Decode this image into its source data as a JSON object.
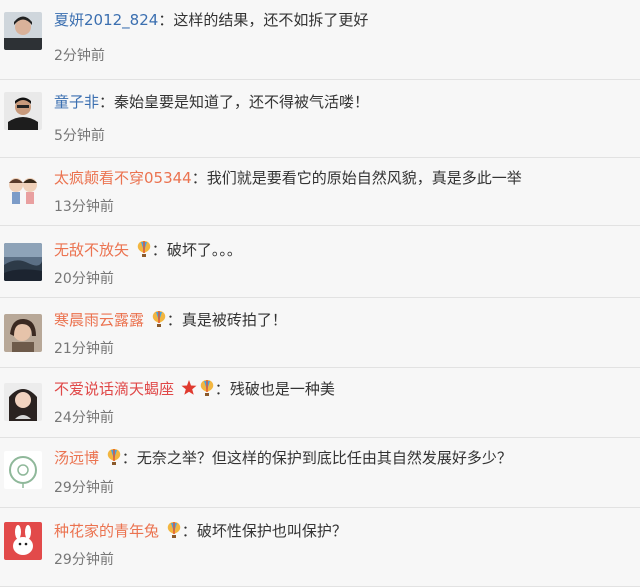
{
  "comments": [
    {
      "user": "夏妍2012_824",
      "text": "这样的结果，还不如拆了更好",
      "time": "2分钟前"
    },
    {
      "user": "童子非",
      "text": "秦始皇要是知道了，还不得被气活喽！",
      "time": "5分钟前"
    },
    {
      "user": "太疯颠看不穿05344",
      "text": "我们就是要看它的原始自然风貌，真是多此一举",
      "time": "13分钟前"
    },
    {
      "user": "无敌不放矢",
      "text": "破坏了。。。",
      "time": "20分钟前"
    },
    {
      "user": "寒晨雨云露露",
      "text": "真是被砖拍了！",
      "time": "21分钟前"
    },
    {
      "user": "不爱说话滴天蝎座",
      "text": "残破也是一种美",
      "time": "24分钟前"
    },
    {
      "user": "汤远博",
      "text": "无奈之举？但这样的保护到底比任由其自然发展好多少？",
      "time": "29分钟前"
    },
    {
      "user": "种花家的青年兔",
      "text": "破坏性保护也叫保护？",
      "time": "29分钟前"
    }
  ],
  "separator": "：",
  "colors": {
    "link_blue": "#3b6fb0",
    "orange": "#eb7350",
    "time_gray": "#777777",
    "background": "#f7f7f7"
  },
  "icons": [
    "balloon-icon",
    "star-icon"
  ]
}
